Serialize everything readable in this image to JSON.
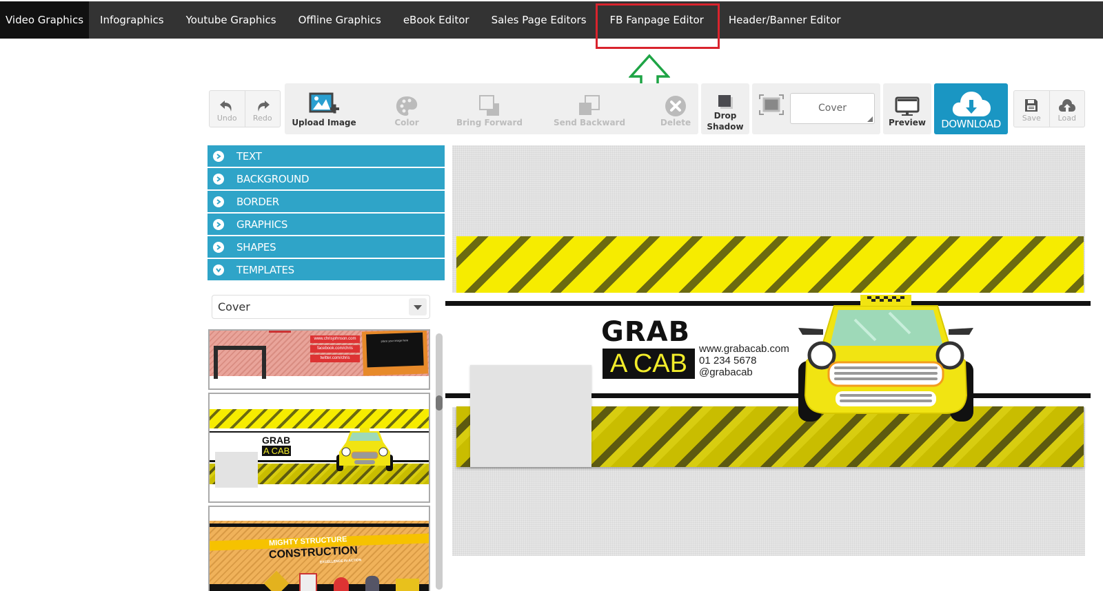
{
  "nav": {
    "items": [
      {
        "label": "Video Graphics",
        "active": true
      },
      {
        "label": "Infographics"
      },
      {
        "label": "Youtube Graphics"
      },
      {
        "label": "Offline Graphics"
      },
      {
        "label": "eBook Editor"
      },
      {
        "label": "Sales Page Editors"
      },
      {
        "label": "FB Fanpage Editor",
        "highlighted": true
      },
      {
        "label": "Header/Banner Editor"
      }
    ],
    "annotation": {
      "highlight_color": "#d9232d",
      "arrow_color": "#1ea445"
    }
  },
  "toolbar": {
    "undo": "Undo",
    "redo": "Redo",
    "upload_image": "Upload Image",
    "color": "Color",
    "bring_forward": "Bring Forward",
    "send_backward": "Send Backward",
    "delete": "Delete",
    "drop_shadow_1": "Drop",
    "drop_shadow_2": "Shadow",
    "size_value": "Cover",
    "preview": "Preview",
    "download": "DOWNLOAD",
    "save": "Save",
    "load": "Load",
    "accent": "#1a96c3"
  },
  "sidebar": {
    "accent": "#2fa4c8",
    "sections": [
      {
        "label": "TEXT",
        "expanded": false
      },
      {
        "label": "BACKGROUND",
        "expanded": false
      },
      {
        "label": "BORDER",
        "expanded": false
      },
      {
        "label": "GRAPHICS",
        "expanded": false
      },
      {
        "label": "SHAPES",
        "expanded": false
      },
      {
        "label": "TEMPLATES",
        "expanded": true
      }
    ],
    "template_select": "Cover",
    "templates": [
      {
        "name": "chris-johnson",
        "lines": [
          "www.chrisjohnson.com",
          "facebook.com/chris",
          "twitter.com/chris"
        ],
        "photo_text": "place your image here"
      },
      {
        "name": "grab-a-cab",
        "title1": "GRAB",
        "title2": "A CAB"
      },
      {
        "name": "mighty-structure",
        "line1": "MIGHTY STRUCTURE",
        "line2": "CONSTRUCTION",
        "line3": "EXCELLENCE IN ACTION"
      }
    ]
  },
  "canvas": {
    "brand_line1": "GRAB",
    "brand_line2": "A CAB",
    "website": "www.grabacab.com",
    "phone": "01 234 5678",
    "handle": "@grabacab"
  }
}
